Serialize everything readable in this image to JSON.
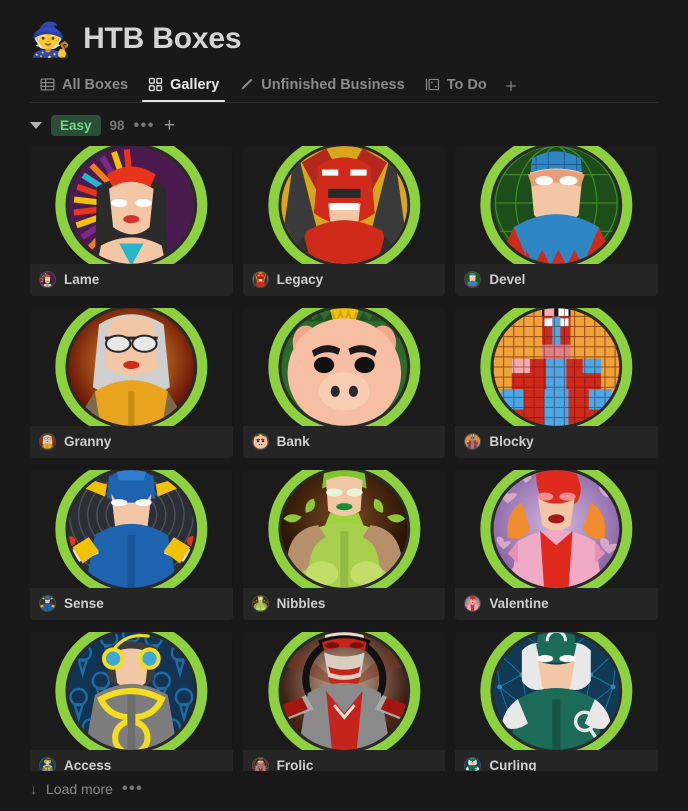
{
  "header": {
    "emoji": "🧙",
    "emoji_name": "wizard-icon",
    "title": "HTB Boxes"
  },
  "tabs": {
    "items": [
      {
        "label": "All Boxes",
        "icon": "table-icon",
        "active": false
      },
      {
        "label": "Gallery",
        "icon": "grid-icon",
        "active": true
      },
      {
        "label": "Unfinished Business",
        "icon": "pen-icon",
        "active": false
      },
      {
        "label": "To Do",
        "icon": "board-icon",
        "active": false
      }
    ],
    "add_label": "+"
  },
  "group": {
    "name": "Easy",
    "count": "98",
    "menu_label": "•••",
    "add_label": "+",
    "badge_bg": "#2b4f36",
    "badge_fg": "#72d68b"
  },
  "footer": {
    "arrow": "↓",
    "load_more_label": "Load more",
    "menu_label": "•••"
  },
  "gallery": {
    "cards": [
      {
        "name": "Lame",
        "art": "lame"
      },
      {
        "name": "Legacy",
        "art": "legacy"
      },
      {
        "name": "Devel",
        "art": "devel"
      },
      {
        "name": "Granny",
        "art": "granny"
      },
      {
        "name": "Bank",
        "art": "bank"
      },
      {
        "name": "Blocky",
        "art": "blocky"
      },
      {
        "name": "Sense",
        "art": "sense"
      },
      {
        "name": "Nibbles",
        "art": "nibbles"
      },
      {
        "name": "Valentine",
        "art": "valentine"
      },
      {
        "name": "Access",
        "art": "access"
      },
      {
        "name": "Frolic",
        "art": "frolic"
      },
      {
        "name": "Curling",
        "art": "curling"
      }
    ]
  }
}
